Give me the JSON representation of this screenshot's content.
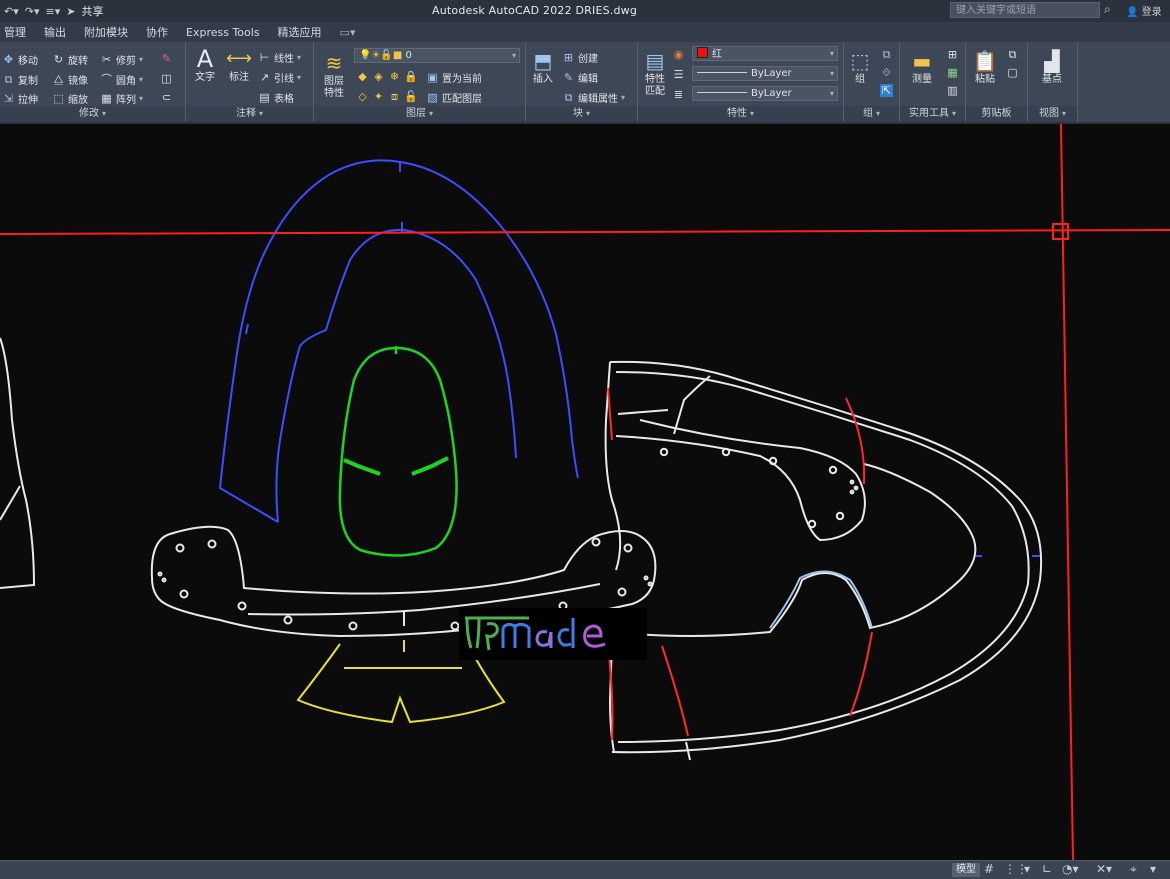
{
  "titlebar": {
    "share_label": "共享",
    "app_title": "Autodesk AutoCAD 2022    DRIES.dwg",
    "search_placeholder": "键入关键字或短语",
    "login_label": "登录"
  },
  "tabs": [
    "管理",
    "输出",
    "附加模块",
    "协作",
    "Express Tools",
    "精选应用"
  ],
  "ribbon": {
    "modify": {
      "title": "修改",
      "tools": [
        "移动",
        "旋转",
        "修剪",
        "复制",
        "镜像",
        "圆角",
        "拉伸",
        "缩放",
        "阵列"
      ]
    },
    "annotation": {
      "title": "注释",
      "text_label": "文字",
      "dim_label": "标注",
      "tools": [
        "线性",
        "引线",
        "表格"
      ]
    },
    "layers": {
      "title": "图层",
      "props_label": "图层特性",
      "current_layer": "0",
      "tools": [
        "置为当前",
        "匹配图层"
      ]
    },
    "block": {
      "title": "块",
      "insert_label": "插入",
      "tools": [
        "创建",
        "编辑",
        "编辑属性"
      ]
    },
    "properties": {
      "title": "特性",
      "match_label": "特性匹配",
      "color_value": "红",
      "linetype_value": "ByLayer",
      "lineweight_value": "ByLayer"
    },
    "groups": {
      "title": "组",
      "group_label": "组"
    },
    "utilities": {
      "title": "实用工具",
      "measure_label": "测量"
    },
    "clipboard": {
      "title": "剪贴板",
      "paste_label": "粘贴"
    },
    "view": {
      "title": "视图",
      "base_label": "基点"
    }
  },
  "colors": {
    "crosshair": "#ff1f1f",
    "pattern_white": "#e9e9e9",
    "pattern_blue": "#3d4dff",
    "pattern_green": "#1fd321",
    "pattern_yellow": "#e8e032",
    "canvas_bg": "#0b0b0c"
  },
  "watermark": {
    "text": "MPmade"
  },
  "statusbar": {
    "model_label": "模型"
  }
}
